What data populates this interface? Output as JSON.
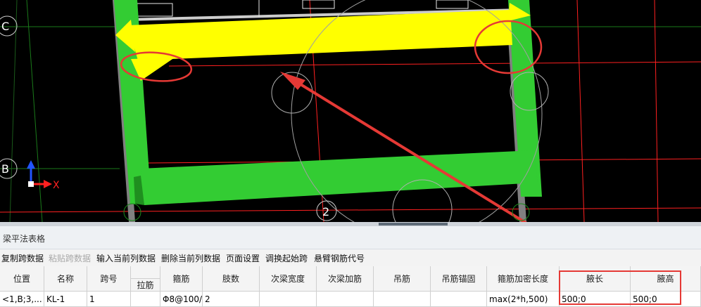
{
  "viewport": {
    "axis_labels": {
      "row_c": "C",
      "row_b": "B",
      "col_2": "2",
      "x_axis": "X"
    },
    "colors": {
      "beam": "#33cc33",
      "highlight": "#ffff00",
      "grid_line": "#ff2020",
      "annotation": "#e53935"
    }
  },
  "panel": {
    "title": "梁平法表格",
    "toolbar": [
      {
        "label": "复制跨数据",
        "enabled": true
      },
      {
        "label": "粘贴跨数据",
        "enabled": false
      },
      {
        "label": "输入当前列数据",
        "enabled": true
      },
      {
        "label": "删除当前列数据",
        "enabled": true
      },
      {
        "label": "页面设置",
        "enabled": true
      },
      {
        "label": "调换起始跨",
        "enabled": true
      },
      {
        "label": "悬臂钢筋代号",
        "enabled": true
      }
    ],
    "table": {
      "headers": {
        "position": "位置",
        "name": "名称",
        "span": "跨号",
        "tie": "拉筋",
        "stirrup": "箍筋",
        "legs": "肢数",
        "sec_width": "次梁宽度",
        "sec_add": "次梁加筋",
        "hanger": "吊筋",
        "hanger_anchor": "吊筋锚固",
        "dense_len": "箍筋加密长度",
        "haunch_len": "腋长",
        "haunch_h": "腋高"
      },
      "row": {
        "position": "<1,B;3,...",
        "name": "KL-1",
        "span": "1",
        "tie": "",
        "stirrup": "Φ8@100/",
        "legs": "2",
        "sec_width": "",
        "sec_add": "",
        "hanger": "",
        "hanger_anchor": "",
        "dense_len": "max(2*h,500)",
        "haunch_len": "500;0",
        "haunch_h": "500;0"
      }
    }
  }
}
